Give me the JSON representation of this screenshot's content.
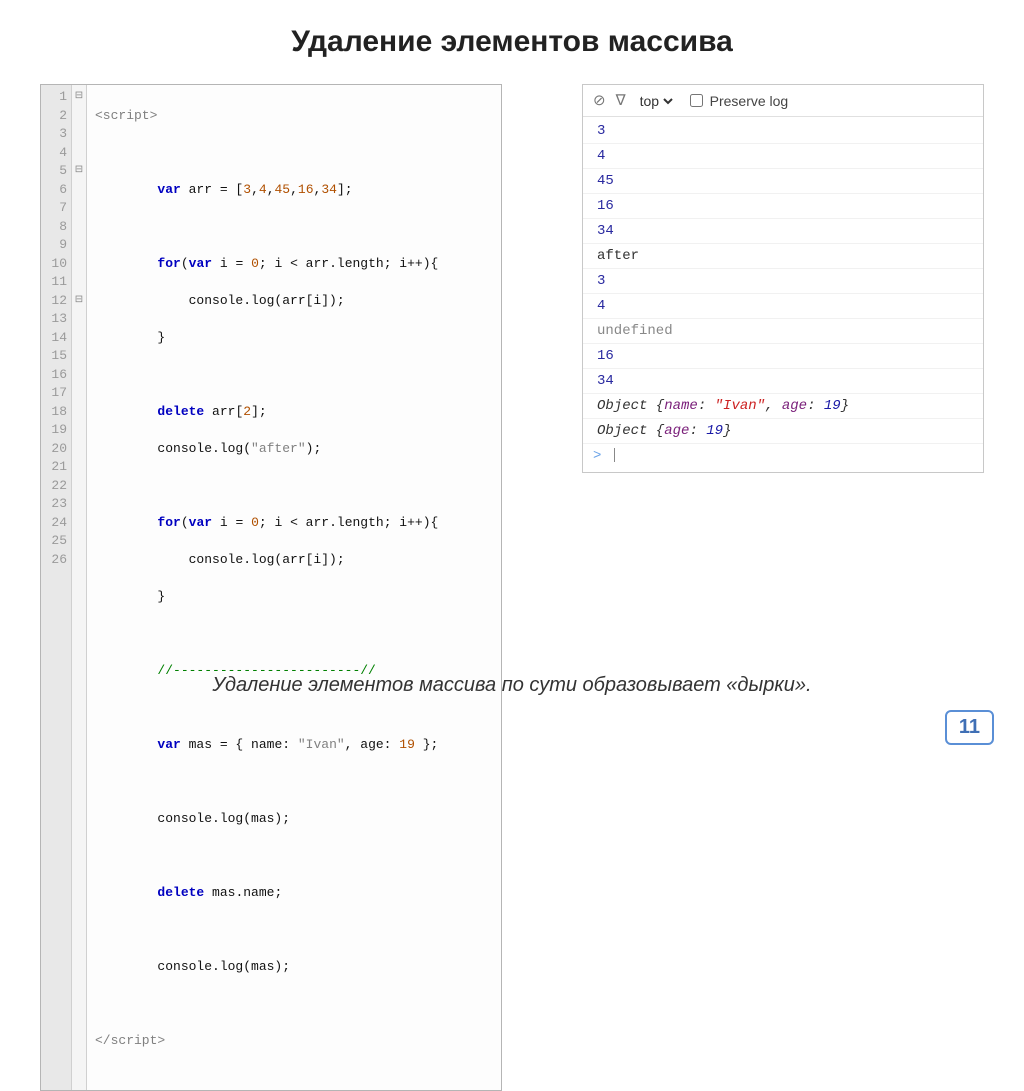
{
  "title": "Удаление элементов массива",
  "caption": "Удаление элементов массива по сути образовывает «дырки».",
  "page_number": "11",
  "code": {
    "line_count": 26,
    "fold_marks": {
      "1": "⊟",
      "5": "⊟",
      "12": "⊟"
    },
    "l1": "<script>",
    "l3a": "var",
    "l3b": " arr = [",
    "l3c": "3",
    "l3d": ",",
    "l3e": "4",
    "l3f": ",",
    "l3g": "45",
    "l3h": ",",
    "l3i": "16",
    "l3j": ",",
    "l3k": "34",
    "l3l": "];",
    "l5a": "for",
    "l5b": "(",
    "l5c": "var",
    "l5d": " i = ",
    "l5e": "0",
    "l5f": "; i < arr.length; i++){",
    "l6": "            console.log(arr[i]);",
    "l7": "        }",
    "l9a": "delete",
    "l9b": " arr[",
    "l9c": "2",
    "l9d": "];",
    "l10a": "        console.log(",
    "l10b": "\"after\"",
    "l10c": ");",
    "l12a": "for",
    "l12b": "(",
    "l12c": "var",
    "l12d": " i = ",
    "l12e": "0",
    "l12f": "; i < arr.length; i++){",
    "l13": "            console.log(arr[i]);",
    "l14": "        }",
    "l16": "        //------------------------//",
    "l18a": "var",
    "l18b": " mas = { name: ",
    "l18c": "\"Ivan\"",
    "l18d": ", age: ",
    "l18e": "19",
    "l18f": " };",
    "l20": "        console.log(mas);",
    "l22a": "delete",
    "l22b": " mas.name;",
    "l24": "        console.log(mas);",
    "l26": "</script>"
  },
  "console": {
    "toolbar": {
      "context": "top",
      "preserve_label": "Preserve log"
    },
    "rows": [
      {
        "text": "3",
        "kind": "num"
      },
      {
        "text": "4",
        "kind": "num"
      },
      {
        "text": "45",
        "kind": "num"
      },
      {
        "text": "16",
        "kind": "num"
      },
      {
        "text": "34",
        "kind": "num"
      },
      {
        "text": "after",
        "kind": "plain"
      },
      {
        "text": "3",
        "kind": "num"
      },
      {
        "text": "4",
        "kind": "num"
      },
      {
        "text": "undefined",
        "kind": "undef"
      },
      {
        "text": "16",
        "kind": "num"
      },
      {
        "text": "34",
        "kind": "num"
      }
    ],
    "obj1": {
      "prefix": "Object ",
      "name_key": "name",
      "name_val": "\"Ivan\"",
      "age_key": "age",
      "age_val": "19"
    },
    "obj2": {
      "prefix": "Object ",
      "age_key": "age",
      "age_val": "19"
    },
    "prompt": ">"
  }
}
